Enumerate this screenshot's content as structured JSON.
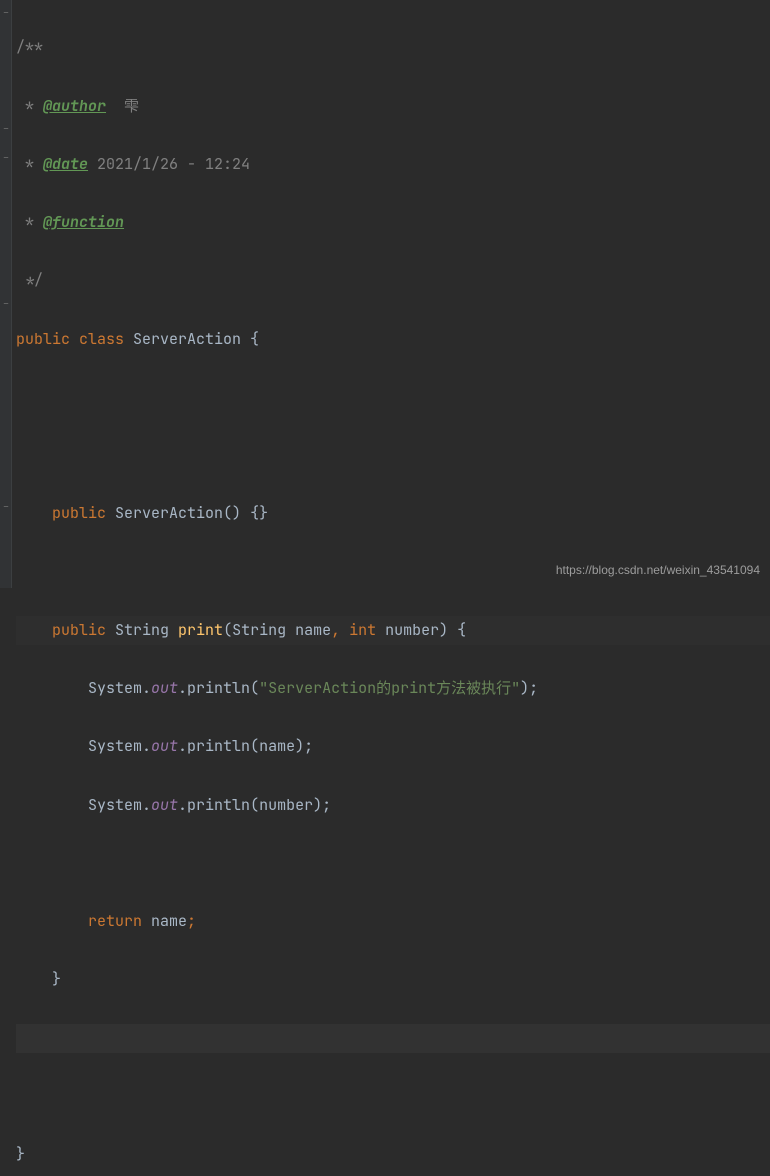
{
  "code": {
    "l1": {
      "open": "/**"
    },
    "l2": {
      "star": " * ",
      "tag": "@author",
      "rest": "  雫"
    },
    "l3": {
      "star": " * ",
      "tag": "@date",
      "rest": " 2021/1/26 - 12:24"
    },
    "l4": {
      "star": " * ",
      "tag": "@function"
    },
    "l5": {
      "star": " */"
    },
    "l6": {
      "kw1": "public ",
      "kw2": "class ",
      "name": "ServerAction ",
      "brace": "{"
    },
    "l7": {
      "empty": ""
    },
    "l8": {
      "empty": ""
    },
    "l9": {
      "indent": "    ",
      "kw": "public ",
      "ctor": "ServerAction",
      "paren": "() ",
      "body": "{}"
    },
    "l10": {
      "empty": ""
    },
    "l11": {
      "indent": "    ",
      "kw": "public ",
      "ret": "String ",
      "name": "print",
      "paren_o": "(",
      "ptype1": "String ",
      "pname1": "name",
      "comma": ", ",
      "ptype2": "int ",
      "pname2": "number",
      "paren_c": ") ",
      "brace": "{"
    },
    "l12": {
      "indent": "        ",
      "sys": "System.",
      "out": "out",
      "call": ".println(",
      "str": "\"ServerAction的print方法被执行\"",
      "end": ");"
    },
    "l13": {
      "indent": "        ",
      "sys": "System.",
      "out": "out",
      "call": ".println(",
      "arg": "name",
      "end": ");"
    },
    "l14": {
      "indent": "        ",
      "sys": "System.",
      "out": "out",
      "call": ".println(",
      "arg": "number",
      "end": ");"
    },
    "l15": {
      "empty": ""
    },
    "l16": {
      "indent": "        ",
      "kw": "return ",
      "val": "name",
      "semi": ";"
    },
    "l17": {
      "indent": "    ",
      "brace": "}"
    },
    "l18": {
      "empty": ""
    },
    "l19": {
      "empty": ""
    },
    "l20": {
      "brace": "}"
    }
  },
  "watermark": "https://blog.csdn.net/weixin_43541094"
}
